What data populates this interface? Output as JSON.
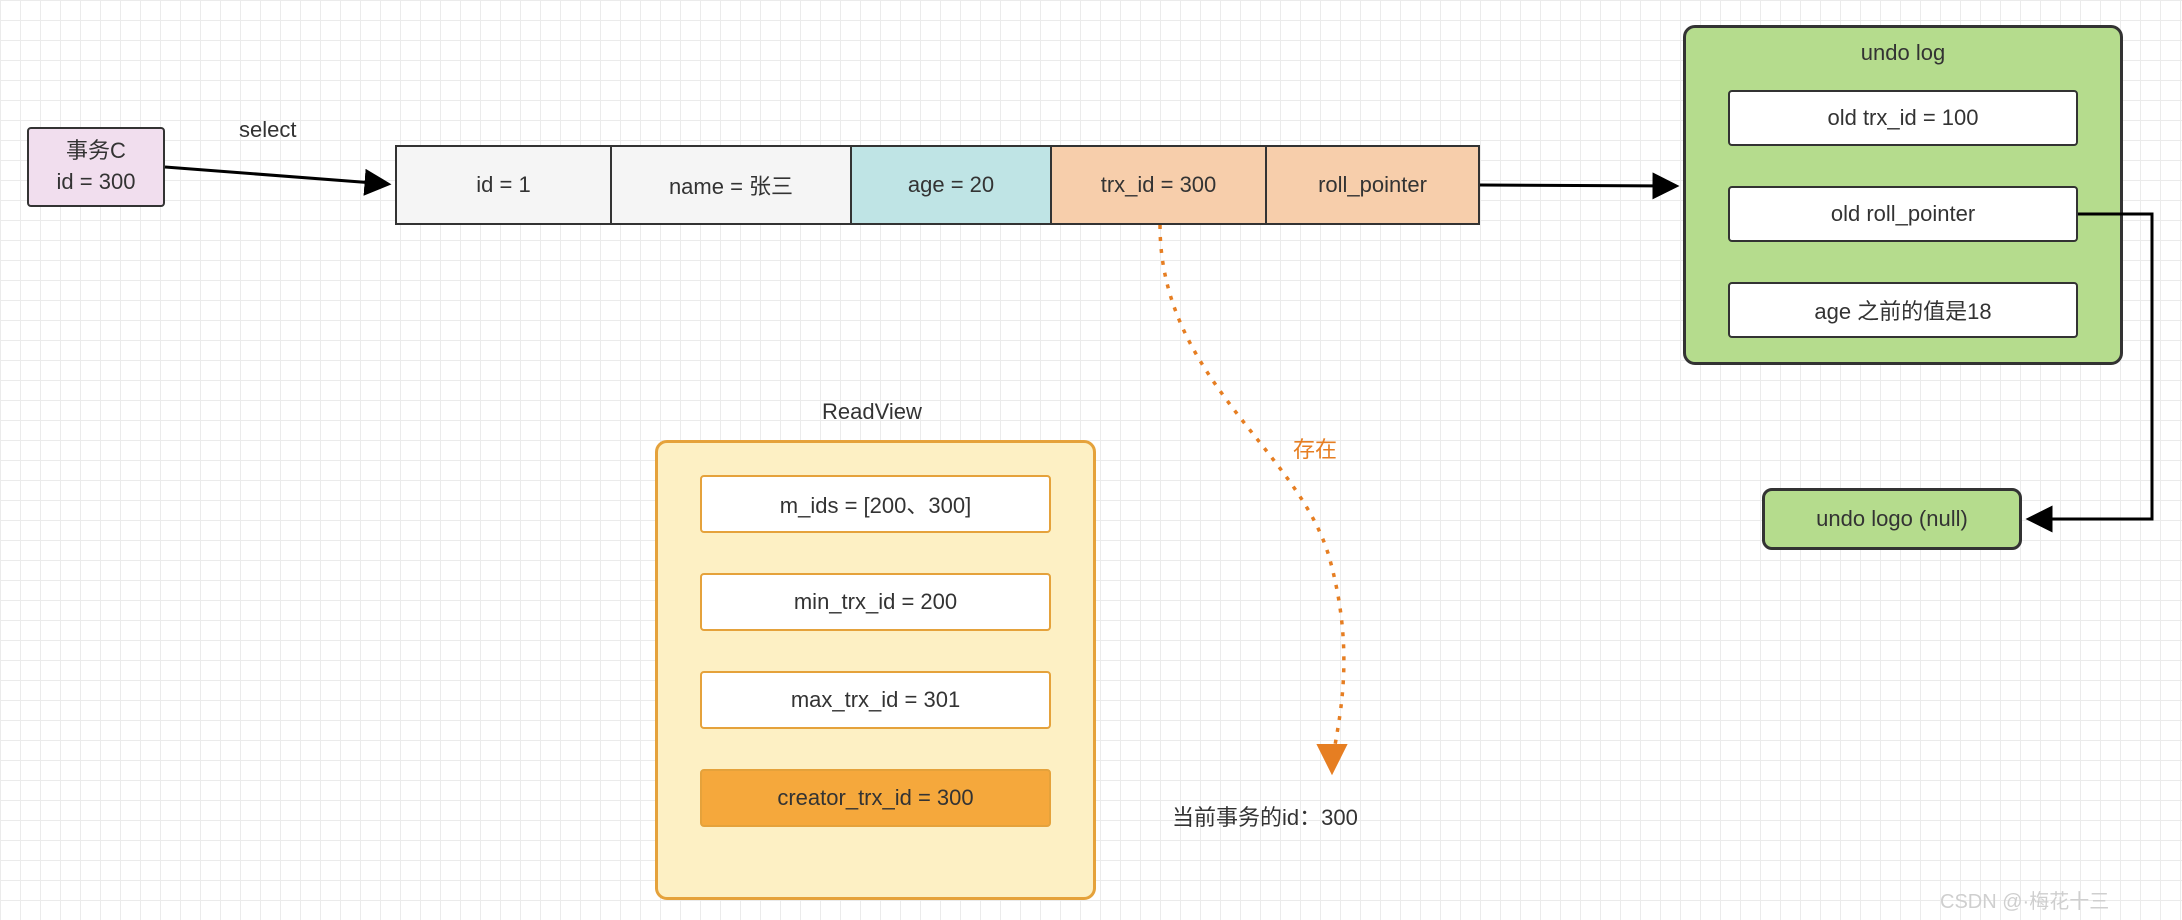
{
  "transaction": {
    "title": "事务C",
    "id_line": "id = 300"
  },
  "select_label": "select",
  "row": {
    "id": "id = 1",
    "name": "name = 张三",
    "age": "age = 20",
    "trx_id": "trx_id = 300",
    "roll_pointer": "roll_pointer"
  },
  "readview": {
    "title": "ReadView",
    "m_ids": "m_ids = [200、300]",
    "min_trx_id": "min_trx_id = 200",
    "max_trx_id": "max_trx_id = 301",
    "creator_trx_id": "creator_trx_id = 300"
  },
  "exists_label": "存在",
  "current_txn_label": "当前事务的id：",
  "current_txn_id": "300",
  "undo_log": {
    "title": "undo log",
    "old_trx_id": "old trx_id = 100",
    "old_roll_pointer": "old roll_pointer",
    "age_prev": "age 之前的值是18"
  },
  "undo_null_label": "undo logo (null)",
  "watermark": "CSDN @·梅花十三"
}
